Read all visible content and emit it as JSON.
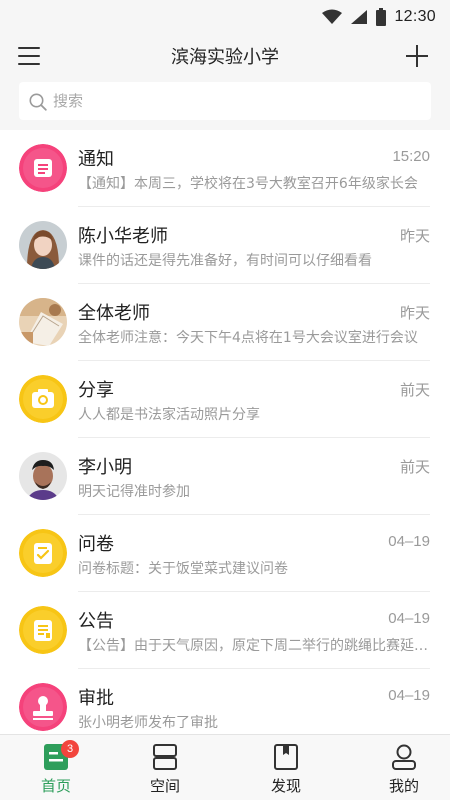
{
  "status_bar": {
    "time": "12:30"
  },
  "header": {
    "title": "滨海实验小学"
  },
  "search": {
    "placeholder": "搜索",
    "value": ""
  },
  "messages": [
    {
      "name": "通知",
      "time": "15:20",
      "preview": "【通知】本周三，学校将在3号大教室召开6年级家长会",
      "avatar_icon": "document-icon",
      "avatar_color": "#f5427b"
    },
    {
      "name": "陈小华老师",
      "time": "昨天",
      "preview": "课件的话还是得先准备好，有时间可以仔细看看",
      "avatar_icon": "user-photo-icon"
    },
    {
      "name": "全体老师",
      "time": "昨天",
      "preview": "全体老师注意：今天下午4点将在1号大会议室进行会议",
      "avatar_icon": "group-photo-icon"
    },
    {
      "name": "分享",
      "time": "前天",
      "preview": "人人都是书法家活动照片分享",
      "avatar_icon": "camera-icon",
      "avatar_color": "#f7c515"
    },
    {
      "name": "李小明",
      "time": "前天",
      "preview": "明天记得准时参加",
      "avatar_icon": "user-photo-icon"
    },
    {
      "name": "问卷",
      "time": "04–19",
      "preview": "问卷标题：关于饭堂菜式建议问卷",
      "avatar_icon": "checklist-icon",
      "avatar_color": "#f7c515"
    },
    {
      "name": "公告",
      "time": "04–19",
      "preview": "【公告】由于天气原因，原定下周二举行的跳绳比赛延期举行",
      "avatar_icon": "announcement-icon",
      "avatar_color": "#f7c515"
    },
    {
      "name": "审批",
      "time": "04–19",
      "preview": "张小明老师发布了审批",
      "avatar_icon": "stamp-icon",
      "avatar_color": "#f5427b"
    }
  ],
  "bottom_nav": [
    {
      "label": "首页",
      "icon": "home-icon",
      "badge": "3",
      "active": true
    },
    {
      "label": "空间",
      "icon": "space-icon",
      "active": false
    },
    {
      "label": "发现",
      "icon": "discover-icon",
      "active": false
    },
    {
      "label": "我的",
      "icon": "profile-icon",
      "active": false
    }
  ],
  "colors": {
    "accent": "#2e9e5b",
    "badge": "#f2453d",
    "pink": "#f5427b",
    "yellow": "#f7c515"
  }
}
